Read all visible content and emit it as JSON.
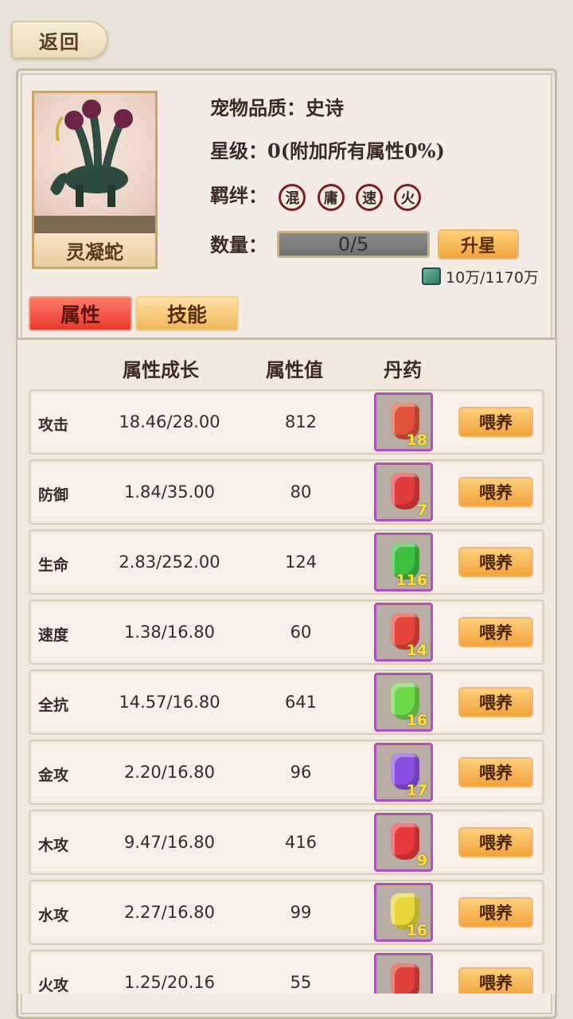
{
  "header": {
    "back_label": "返回"
  },
  "pet": {
    "name": "灵凝蛇",
    "quality_label": "宠物品质：",
    "quality_value": "史诗",
    "star_label": "星级：",
    "star_value": "0(附加所有属性0%)",
    "bond_label": "羁绊：",
    "bonds": [
      "混",
      "庸",
      "速",
      "火"
    ],
    "quantity_label": "数量：",
    "quantity_value": "0/5",
    "quantity_progress": 0,
    "upgrade_star_label": "升星",
    "currency_text": "10万/1170万"
  },
  "tabs": [
    {
      "label": "属性",
      "active": true
    },
    {
      "label": "技能",
      "active": false
    }
  ],
  "table": {
    "headers": [
      "属性成长",
      "属性值",
      "丹药"
    ],
    "feed_label": "喂养",
    "rows": [
      {
        "name": "攻击",
        "growth": "18.46/28.00",
        "value": "812",
        "pill_count": "18",
        "pill_color": "#e0533a"
      },
      {
        "name": "防御",
        "growth": "1.84/35.00",
        "value": "80",
        "pill_count": "7",
        "pill_color": "#e23b3b"
      },
      {
        "name": "生命",
        "growth": "2.83/252.00",
        "value": "124",
        "pill_count": "116",
        "pill_color": "#3fbf3f"
      },
      {
        "name": "速度",
        "growth": "1.38/16.80",
        "value": "60",
        "pill_count": "14",
        "pill_color": "#e6453a"
      },
      {
        "name": "全抗",
        "growth": "14.57/16.80",
        "value": "641",
        "pill_count": "16",
        "pill_color": "#6ed94a"
      },
      {
        "name": "金攻",
        "growth": "2.20/16.80",
        "value": "96",
        "pill_count": "17",
        "pill_color": "#8a4fe0"
      },
      {
        "name": "木攻",
        "growth": "9.47/16.80",
        "value": "416",
        "pill_count": "9",
        "pill_color": "#e8393e"
      },
      {
        "name": "水攻",
        "growth": "2.27/16.80",
        "value": "99",
        "pill_count": "16",
        "pill_color": "#e8d63a"
      },
      {
        "name": "火攻",
        "growth": "1.25/20.16",
        "value": "55",
        "pill_count": "",
        "pill_color": "#e0403a"
      }
    ]
  }
}
